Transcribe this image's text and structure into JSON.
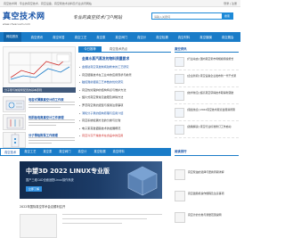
{
  "topbar": {
    "text": "真空技术网 · 专业的真空技术、真空设备、真空泵技术资料及行业资讯网站",
    "login": "登录 | 注册"
  },
  "header": {
    "logo_title": "真空技术网",
    "logo_url": "www.chvacuum.com",
    "slogan": "专业的真空技术门户网站",
    "search_placeholder": "请输入关键词",
    "search_button": "搜索"
  },
  "nav": {
    "items": [
      "网站首页",
      "真空资讯",
      "真空问答",
      "真空工艺",
      "真空泵",
      "真空阀门",
      "真空计",
      "真空检漏",
      "真空材料",
      "真空镀膜",
      "真空展会"
    ]
  },
  "left": {
    "caption": "分子泵与前级泵配置的基本原则",
    "thumbs": [
      {
        "title": "电容式薄膜真空计的工作原"
      },
      {
        "title": "热阴极电离真空计工作原理"
      },
      {
        "title": "分子筛吸附泵工作原理"
      }
    ]
  },
  "middle": {
    "tabs": [
      "今日推荐",
      "真空技术热点"
    ],
    "headline": "金属水蒸汽蒸发的物料质量要求",
    "items": [
      {
        "text": "金属钛真空蒸发制纯钛粉末的工艺研究",
        "style": "hl"
      },
      {
        "text": "真空镀膜技术在工业中的应用现状与前景",
        "style": ""
      },
      {
        "text": "磁控溅射镀膜工艺参数的优化研究",
        "style": "hl"
      },
      {
        "text": "真空热处理炉的结构特点与维护方法",
        "style": ""
      },
      {
        "text": "旋片式真空泵常见故障及排除方法",
        "style": ""
      },
      {
        "text": "罗茨真空泵的选型与使用注意事项",
        "style": ""
      },
      {
        "text": "涡轮分子泵的结构原理与应用介绍",
        "style": "hl"
      },
      {
        "text": "真空系统检漏方法的分类与比较",
        "style": ""
      },
      {
        "text": "电子束蒸发镀膜技术的发展概况",
        "style": ""
      },
      {
        "text": "真空冷冻干燥技术在食品中的应用",
        "style": "red"
      }
    ]
  },
  "right": {
    "title": "真空资讯",
    "items": [
      {
        "text": "[行业动态] 国内真空泵市场规模持续增长"
      },
      {
        "text": "[企业新闻] 真空设备企业发布新一代干式泵"
      },
      {
        "text": "[技术前沿] 超高真空获得技术取得新突破"
      },
      {
        "text": "[展会信息] 2022真空技术展览会圆满闭幕"
      },
      {
        "text": "[政策解读] 真空行业标准修订工作启动"
      }
    ]
  },
  "nav2": {
    "items": [
      "真空技术",
      "真空工艺",
      "真空泵",
      "真空阀门",
      "真空计",
      "真空检漏",
      "真空材料"
    ]
  },
  "banner": {
    "title": "中望3D 2022 LINUX专业版",
    "subtitle": "国产三维CAD全面适配Linux操作系统",
    "button": "立即了解"
  },
  "news_row": "2022年国际真空学术会议顺利召开",
  "right_lower": {
    "title": "阅读排行",
    "items": [
      {
        "text": "真空泵油的选择与更换周期详解"
      },
      {
        "text": "真空镀膜机操作规程及注意事项"
      },
      {
        "text": "真空计的分类与测量范围说明"
      }
    ]
  },
  "colors": {
    "primary": "#1a7cc8",
    "link": "#1a55a8",
    "highlight": "#d0312d"
  }
}
